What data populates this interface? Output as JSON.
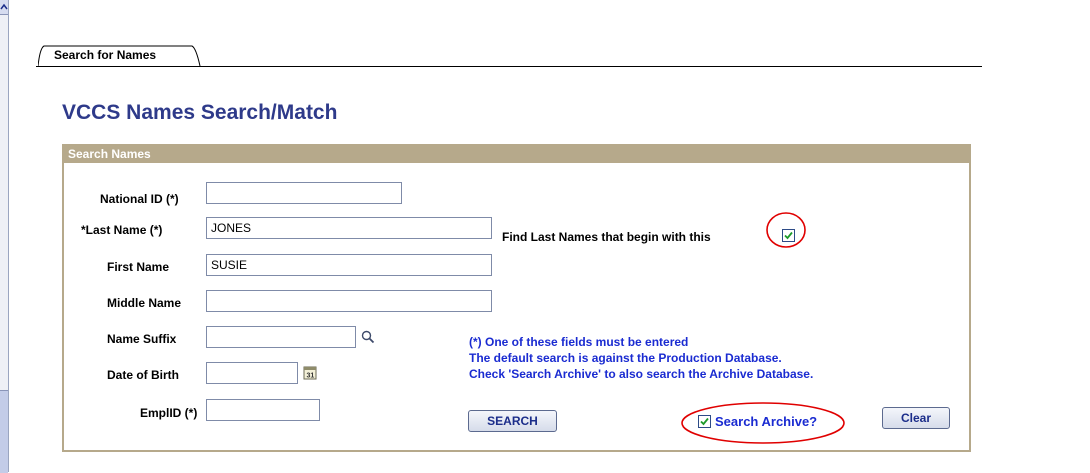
{
  "tab": {
    "label": "Search for Names"
  },
  "page_title": "VCCS Names Search/Match",
  "group": {
    "title": "Search Names"
  },
  "form": {
    "national_id": {
      "label": "National ID (*)",
      "value": ""
    },
    "last_name": {
      "label": "*Last Name (*)",
      "value": "JONES"
    },
    "begins_with": {
      "label": "Find Last Names that begin with this",
      "checked": true
    },
    "first_name": {
      "label": "First Name",
      "value": "SUSIE"
    },
    "middle_name": {
      "label": "Middle Name",
      "value": ""
    },
    "name_suffix": {
      "label": "Name Suffix",
      "value": ""
    },
    "date_of_birth": {
      "label": "Date of Birth",
      "value": ""
    },
    "emplid": {
      "label": "EmplID (*)",
      "value": ""
    }
  },
  "notes": {
    "line1": "(*) One of these fields must be entered",
    "line2": "The default search is against the Production Database.",
    "line3": "Check 'Search Archive' to also search the Archive Database."
  },
  "buttons": {
    "search": "SEARCH",
    "search_archive": "Search Archive?",
    "clear": "Clear"
  },
  "search_archive_checked": true,
  "colors": {
    "title": "#2e3a8a",
    "group_header": "#b6a98b",
    "note_text": "#1a2bd1",
    "highlight": "#e00000"
  },
  "icons": [
    "scroll-up-arrow-icon",
    "lookup-magnifier-icon",
    "calendar-icon",
    "checkmark-icon"
  ]
}
